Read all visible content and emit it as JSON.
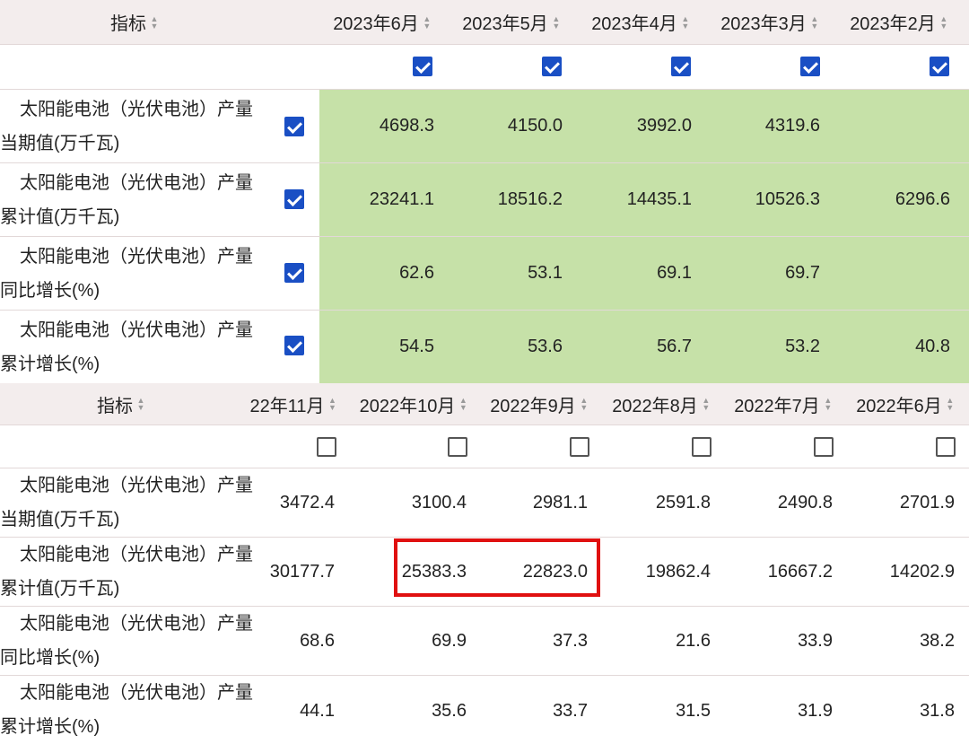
{
  "table_2023": {
    "header": {
      "indicator_label": "指标",
      "columns": [
        "2023年6月",
        "2023年5月",
        "2023年4月",
        "2023年3月",
        "2023年2月"
      ]
    },
    "column_checkboxes": [
      true,
      true,
      true,
      true,
      true
    ],
    "rows": [
      {
        "label_line1": "太阳能电池（光伏电池）产量",
        "label_line2": "当期值(万千瓦)",
        "checked": true,
        "values": [
          "4698.3",
          "4150.0",
          "3992.0",
          "4319.6",
          ""
        ]
      },
      {
        "label_line1": "太阳能电池（光伏电池）产量",
        "label_line2": "累计值(万千瓦)",
        "checked": true,
        "values": [
          "23241.1",
          "18516.2",
          "14435.1",
          "10526.3",
          "6296.6"
        ]
      },
      {
        "label_line1": "太阳能电池（光伏电池）产量",
        "label_line2": "同比增长(%)",
        "checked": true,
        "values": [
          "62.6",
          "53.1",
          "69.1",
          "69.7",
          ""
        ]
      },
      {
        "label_line1": "太阳能电池（光伏电池）产量",
        "label_line2": "累计增长(%)",
        "checked": true,
        "values": [
          "54.5",
          "53.6",
          "56.7",
          "53.2",
          "40.8"
        ]
      }
    ],
    "highlight_color": "#c6e1a8"
  },
  "table_2022": {
    "header": {
      "indicator_label": "指标",
      "columns": [
        "22年11月",
        "2022年10月",
        "2022年9月",
        "2022年8月",
        "2022年7月",
        "2022年6月"
      ]
    },
    "column_checkboxes": [
      false,
      false,
      false,
      false,
      false,
      false
    ],
    "rows": [
      {
        "label_line1": "太阳能电池（光伏电池）产量",
        "label_line2": "当期值(万千瓦)",
        "values": [
          "3472.4",
          "3100.4",
          "2981.1",
          "2591.8",
          "2490.8",
          "2701.9"
        ]
      },
      {
        "label_line1": "太阳能电池（光伏电池）产量",
        "label_line2": "累计值(万千瓦)",
        "values": [
          "30177.7",
          "25383.3",
          "22823.0",
          "19862.4",
          "16667.2",
          "14202.9"
        ]
      },
      {
        "label_line1": "太阳能电池（光伏电池）产量",
        "label_line2": "同比增长(%)",
        "values": [
          "68.6",
          "69.9",
          "37.3",
          "21.6",
          "33.9",
          "38.2"
        ]
      },
      {
        "label_line1": "太阳能电池（光伏电池）产量",
        "label_line2": "累计增长(%)",
        "values": [
          "44.1",
          "35.6",
          "33.7",
          "31.5",
          "31.9",
          "31.8"
        ]
      }
    ],
    "annotation_box_color": "#e01010"
  }
}
